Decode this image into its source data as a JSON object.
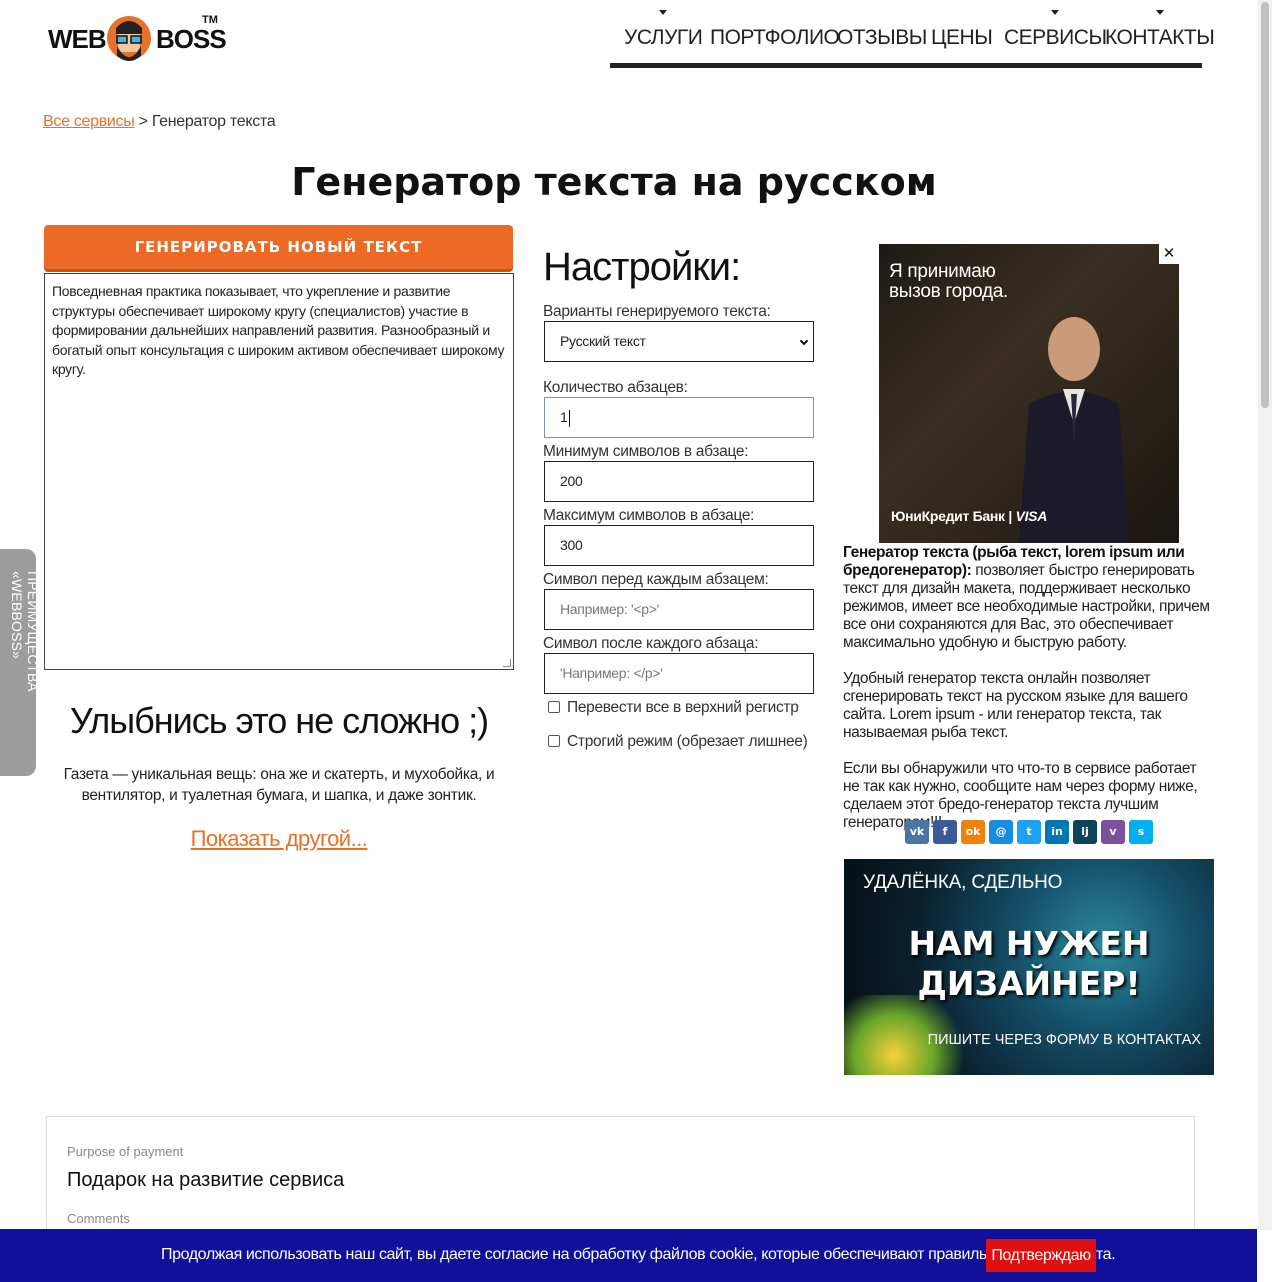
{
  "logo": {
    "word1": "WEB",
    "word2": "BOSS",
    "tm": "TM"
  },
  "nav": [
    {
      "label": "УСЛУГИ",
      "has_dropdown": true
    },
    {
      "label": "ПОРТФОЛИО",
      "has_dropdown": false
    },
    {
      "label": "ОТЗЫВЫ",
      "has_dropdown": false
    },
    {
      "label": "ЦЕНЫ",
      "has_dropdown": false
    },
    {
      "label": "СЕРВИСЫ",
      "has_dropdown": true
    },
    {
      "label": "КОНТАКТЫ",
      "has_dropdown": true
    }
  ],
  "breadcrumb": {
    "link": "Все сервисы",
    "separator": ">",
    "current": "Генератор текста"
  },
  "page_title": "Генератор текста на русском",
  "generator": {
    "button_label": "ГЕНЕРИРОВАТЬ НОВЫЙ ТЕКСТ",
    "output_text": "Повседневная практика показывает, что укрепление и развитие структуры обеспечивает широкому кругу (специалистов) участие в формировании дальнейших направлений развития. Разнообразный и богатый опыт консультация с широким активом обеспечивает широкому кругу."
  },
  "smile": {
    "title": "Улыбнись это не сложно ;)",
    "quote": "Газета — уникальная вещь: она же и скатерть, и мухобойка, и вентилятор, и туалетная бумага, и шапка, и даже зонтик.",
    "link": "Показать другой..."
  },
  "settings": {
    "title": "Настройки:",
    "variant_label": "Варианты генерируемого текста:",
    "variant_value": "Русский текст",
    "paragraphs_label": "Количество абзацев:",
    "paragraphs_value": "1",
    "min_label": "Минимум символов в абзаце:",
    "min_value": "200",
    "max_label": "Максимум символов в абзаце:",
    "max_value": "300",
    "before_label": "Символ перед каждым абзацем:",
    "before_placeholder": "Например: '<p>'",
    "after_label": "Символ после каждого абзаца:",
    "after_placeholder": "'Например: </p>'",
    "uppercase_label": "Перевести все в верхний регистр",
    "strict_label": "Строгий режим (обрезает лишнее)"
  },
  "ad_bank": {
    "headline_line1": "Я принимаю",
    "headline_line2": "вызов города.",
    "close": "✕",
    "brand": "ЮниКредит Банк",
    "brand_divider": "|",
    "card": "VISA"
  },
  "description": {
    "bold": "Генератор текста (рыба текст, lorem ipsum или бредогенератор):",
    "p1_rest": " позволяет быстро генерировать текст для дизайн макета, поддерживает несколько режимов, имеет все необходимые настройки, причем все они сохраняются для Вас, это обеспечивает максимально удобную и быструю работу.",
    "p2": "Удобный генератор текста онлайн позволяет сгенерировать текст на русском языке для вашего сайта. Lorem ipsum - или генератор текста, так называемая рыба текст.",
    "p3": "Если вы обнаружили что что-то в сервисе работает не так как нужно, сообщите нам через форму ниже, сделаем этот бредо-генератор текста лучшим генератором!!!"
  },
  "share": [
    {
      "icon": "vk-icon",
      "glyph": "vk",
      "color": "#4c75a3"
    },
    {
      "icon": "facebook-icon",
      "glyph": "f",
      "color": "#3b5998"
    },
    {
      "icon": "odnoklassniki-icon",
      "glyph": "ok",
      "color": "#ee8208"
    },
    {
      "icon": "moimir-icon",
      "glyph": "@",
      "color": "#168de2"
    },
    {
      "icon": "twitter-icon",
      "glyph": "t",
      "color": "#1da1f2"
    },
    {
      "icon": "linkedin-icon",
      "glyph": "in",
      "color": "#0077b5"
    },
    {
      "icon": "livejournal-icon",
      "glyph": "lj",
      "color": "#0d425a"
    },
    {
      "icon": "viber-icon",
      "glyph": "v",
      "color": "#7b519d"
    },
    {
      "icon": "skype-icon",
      "glyph": "s",
      "color": "#00aff0"
    }
  ],
  "ad_designer": {
    "top": "УДАЛЁНКА, СДЕЛЬНО",
    "line1": "НАМ НУЖЕН",
    "line2": "ДИЗАЙНЕР!",
    "bottom": "ПИШИТЕ ЧЕРЕЗ ФОРМУ В КОНТАКТАХ"
  },
  "side_tab": "ПРЕИМУЩЕСТВА «WEBBOSS»",
  "payment": {
    "purpose_label": "Purpose of payment",
    "purpose_value": "Подарок на развитие сервиса",
    "comments_label": "Comments"
  },
  "cookie": {
    "message": "Продолжая использовать наш сайт, вы даете согласие на обработку файлов cookie, которые обеспечивают правильную работу сайта.",
    "button": "Подтверждаю"
  }
}
